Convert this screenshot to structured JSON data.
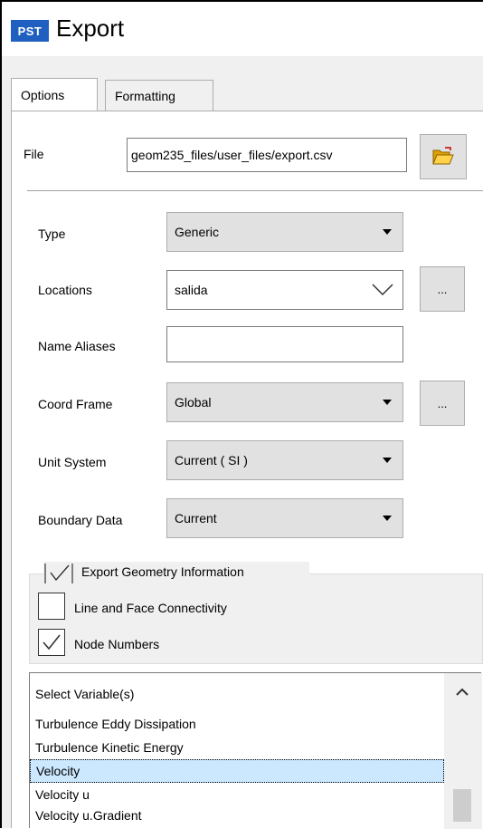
{
  "window": {
    "app_icon_text": "PST",
    "title": "Export"
  },
  "tabs": [
    {
      "label": "Options",
      "active": true
    },
    {
      "label": "Formatting",
      "active": false
    }
  ],
  "file": {
    "label": "File",
    "value": "geom235_files/user_files/export.csv",
    "browse_icon": "folder-open-icon"
  },
  "fields": {
    "type": {
      "label": "Type",
      "value": "Generic"
    },
    "locations": {
      "label": "Locations",
      "value": "salida",
      "more": "..."
    },
    "name_aliases": {
      "label": "Name Aliases",
      "value": ""
    },
    "coord_frame": {
      "label": "Coord Frame",
      "value": "Global",
      "more": "..."
    },
    "unit_system": {
      "label": "Unit System",
      "value": "Current ( SI )"
    },
    "boundary_data": {
      "label": "Boundary Data",
      "value": "Current"
    }
  },
  "geometry": {
    "label": "Export Geometry Information",
    "checked": true,
    "options": [
      {
        "label": "Line and Face Connectivity",
        "checked": false
      },
      {
        "label": "Node Numbers",
        "checked": true
      }
    ]
  },
  "variables": {
    "header": "Select Variable(s)",
    "items": [
      {
        "label": "Turbulence Eddy Dissipation",
        "selected": false
      },
      {
        "label": "Turbulence Kinetic Energy",
        "selected": false
      },
      {
        "label": "Velocity",
        "selected": true
      },
      {
        "label": "Velocity u",
        "selected": false
      },
      {
        "label": "Velocity u.Gradient",
        "selected": false
      }
    ]
  },
  "colors": {
    "accent": "#1f5fbf",
    "selection": "#cce8ff",
    "button_face": "#e1e1e1",
    "panel": "#f0f0f0"
  }
}
